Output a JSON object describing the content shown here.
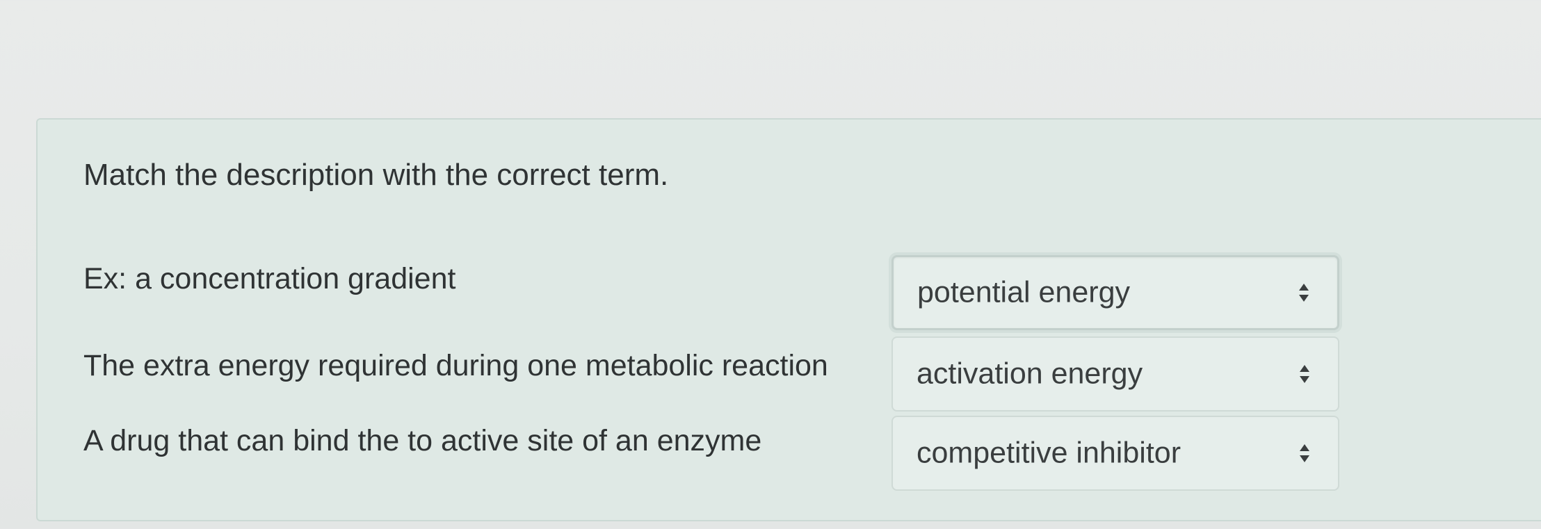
{
  "question": {
    "prompt": "Match the description with the correct term."
  },
  "rows": [
    {
      "description": "Ex: a concentration gradient",
      "selected": "potential energy"
    },
    {
      "description": "The extra energy required during one metabolic reaction",
      "selected": "activation energy"
    },
    {
      "description": "A drug that can bind the to active site of an enzyme",
      "selected": "competitive inhibitor"
    }
  ],
  "icons": {
    "select_caret": "up-down-caret-icon"
  },
  "colors": {
    "panel_background": "#dfe9e5",
    "text": "#2f3334"
  }
}
